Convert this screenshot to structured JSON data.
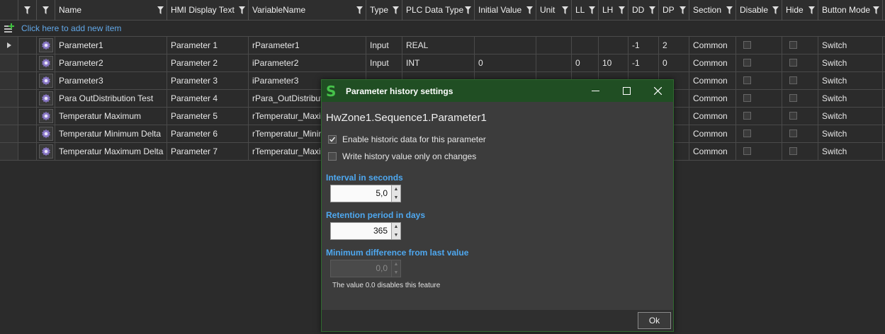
{
  "grid": {
    "columns": [
      {
        "key": "ind",
        "label": "",
        "width": 26,
        "filter": false
      },
      {
        "key": "f1",
        "label": "",
        "width": 26,
        "filter": true
      },
      {
        "key": "icon",
        "label": "",
        "width": 26,
        "filter": true
      },
      {
        "key": "name",
        "label": "Name",
        "width": 158,
        "filter": true
      },
      {
        "key": "hmi",
        "label": "HMI Display Text",
        "width": 115,
        "filter": true
      },
      {
        "key": "var",
        "label": "VariableName",
        "width": 166,
        "filter": true
      },
      {
        "key": "type",
        "label": "Type",
        "width": 51,
        "filter": true
      },
      {
        "key": "plc",
        "label": "PLC Data Type",
        "width": 102,
        "filter": true
      },
      {
        "key": "init",
        "label": "Initial Value",
        "width": 87,
        "filter": true
      },
      {
        "key": "unit",
        "label": "Unit",
        "width": 50,
        "filter": true
      },
      {
        "key": "ll",
        "label": "LL",
        "width": 38,
        "filter": true
      },
      {
        "key": "lh",
        "label": "LH",
        "width": 42,
        "filter": true
      },
      {
        "key": "dd",
        "label": "DD",
        "width": 43,
        "filter": true
      },
      {
        "key": "dp",
        "label": "DP",
        "width": 43,
        "filter": true
      },
      {
        "key": "section",
        "label": "Section",
        "width": 66,
        "filter": true
      },
      {
        "key": "disable",
        "label": "Disable",
        "width": 65,
        "filter": true
      },
      {
        "key": "hide",
        "label": "Hide",
        "width": 51,
        "filter": true
      },
      {
        "key": "button",
        "label": "Button Mode",
        "width": 91,
        "filter": true
      }
    ],
    "add_item_label": "Click here to add new item",
    "rows": [
      {
        "current": true,
        "name": "Parameter1",
        "hmi": "Parameter 1",
        "var": "rParameter1",
        "type": "Input",
        "plc": "REAL",
        "init": "",
        "unit": "",
        "ll": "",
        "lh": "",
        "dd": "-1",
        "dp": "2",
        "section": "Common",
        "button": "Switch"
      },
      {
        "current": false,
        "name": "Parameter2",
        "hmi": "Parameter 2",
        "var": "iParameter2",
        "type": "Input",
        "plc": "INT",
        "init": "0",
        "unit": "",
        "ll": "0",
        "lh": "10",
        "dd": "-1",
        "dp": "0",
        "section": "Common",
        "button": "Switch"
      },
      {
        "current": false,
        "name": "Parameter3",
        "hmi": "Parameter 3",
        "var": "iParameter3",
        "type": "",
        "plc": "",
        "init": "",
        "unit": "",
        "ll": "",
        "lh": "",
        "dd": "",
        "dp": "",
        "section": "Common",
        "button": "Switch"
      },
      {
        "current": false,
        "name": "Para OutDistribution Test",
        "hmi": "Parameter 4",
        "var": "rPara_OutDistribut",
        "type": "",
        "plc": "",
        "init": "",
        "unit": "",
        "ll": "",
        "lh": "",
        "dd": "",
        "dp": "",
        "section": "Common",
        "button": "Switch"
      },
      {
        "current": false,
        "name": "Temperatur Maximum",
        "hmi": "Parameter 5",
        "var": "rTemperatur_Maxi",
        "type": "",
        "plc": "",
        "init": "",
        "unit": "",
        "ll": "",
        "lh": "",
        "dd": "",
        "dp": "",
        "section": "Common",
        "button": "Switch"
      },
      {
        "current": false,
        "name": "Temperatur Minimum Delta",
        "hmi": "Parameter 6",
        "var": "rTemperatur_Minir",
        "type": "",
        "plc": "",
        "init": "",
        "unit": "",
        "ll": "",
        "lh": "",
        "dd": "",
        "dp": "",
        "section": "Common",
        "button": "Switch"
      },
      {
        "current": false,
        "name": "Temperatur Maximum Delta",
        "hmi": "Parameter 7",
        "var": "rTemperatur_Maxi",
        "type": "",
        "plc": "",
        "init": "",
        "unit": "",
        "ll": "",
        "lh": "",
        "dd": "",
        "dp": "",
        "section": "Common",
        "button": "Switch"
      }
    ]
  },
  "dialog": {
    "logo": "S",
    "title": "Parameter history settings",
    "path": "HwZone1.Sequence1.Parameter1",
    "enable_historic_label": "Enable historic data for this parameter",
    "enable_historic_checked": true,
    "write_on_change_label": "Write history value only on changes",
    "write_on_change_checked": false,
    "interval_label": "Interval in seconds",
    "interval_value": "5,0",
    "retention_label": "Retention period in days",
    "retention_value": "365",
    "min_diff_label": "Minimum difference from last value",
    "min_diff_value": "0,0",
    "min_diff_enabled": false,
    "hint": "The value 0.0 disables this feature",
    "ok_label": "Ok"
  },
  "colors": {
    "title_bar": "#204e23",
    "accent_label": "#4ea8f0",
    "add_item_link": "#62a8e8",
    "logo": "#46c24a"
  }
}
